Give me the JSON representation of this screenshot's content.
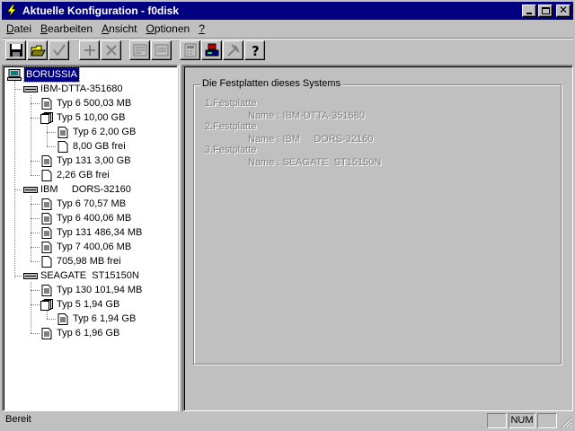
{
  "window": {
    "title": "Aktuelle Konfiguration - f0disk",
    "title_bg": "#000080"
  },
  "menu": [
    {
      "label": "Datei",
      "ul": "D",
      "rest": "atei"
    },
    {
      "label": "Bearbeiten",
      "ul": "B",
      "rest": "earbeiten"
    },
    {
      "label": "Ansicht",
      "ul": "A",
      "rest": "nsicht"
    },
    {
      "label": "Optionen",
      "ul": "O",
      "rest": "ptionen"
    },
    {
      "label": "?",
      "ul": "?",
      "rest": ""
    }
  ],
  "toolbar": {
    "buttons": [
      "save-icon",
      "open-folder-icon",
      "checkmark-icon",
      "add-icon",
      "delete-icon",
      "window-icon",
      "window-list-icon",
      "calculator-icon",
      "computer-icon",
      "tools-icon",
      "help-icon"
    ]
  },
  "tree": {
    "root": "BORUSSIA",
    "disks": [
      {
        "name": "IBM-DTTA-351680",
        "partitions": [
          {
            "label": "Typ 6  500,03 MB"
          },
          {
            "label": "Typ 5  10,00 GB",
            "children": [
              "Typ 6  2,00 GB",
              "8,00 GB frei"
            ]
          },
          {
            "label": "Typ 131  3,00 GB"
          },
          {
            "label": "2,26 GB frei"
          }
        ]
      },
      {
        "name": "IBM     DORS-32160",
        "partitions": [
          {
            "label": "Typ 6  70,57 MB"
          },
          {
            "label": "Typ 6  400,06 MB"
          },
          {
            "label": "Typ 131  486,34 MB"
          },
          {
            "label": "Typ 7  400,06 MB"
          },
          {
            "label": "705,98 MB frei"
          }
        ]
      },
      {
        "name": "SEAGATE  ST15150N",
        "partitions": [
          {
            "label": "Typ 130  101,94 MB"
          },
          {
            "label": "Typ 5  1,94 GB",
            "children": [
              "Typ 6  1,94 GB"
            ]
          },
          {
            "label": "Typ 6  1,96 GB"
          }
        ]
      }
    ]
  },
  "details": {
    "group_title": "Die Festplatten dieses Systems",
    "disks": [
      {
        "heading": "1.Festplatte",
        "name_line": "Name : IBM-DTTA-351680"
      },
      {
        "heading": "2.Festplatte",
        "name_line": "Name : IBM     DORS-32160"
      },
      {
        "heading": "3.Festplatte",
        "name_line": "Name : SEAGATE  ST15150N"
      }
    ]
  },
  "status": {
    "text": "Bereit",
    "num": "NUM"
  }
}
